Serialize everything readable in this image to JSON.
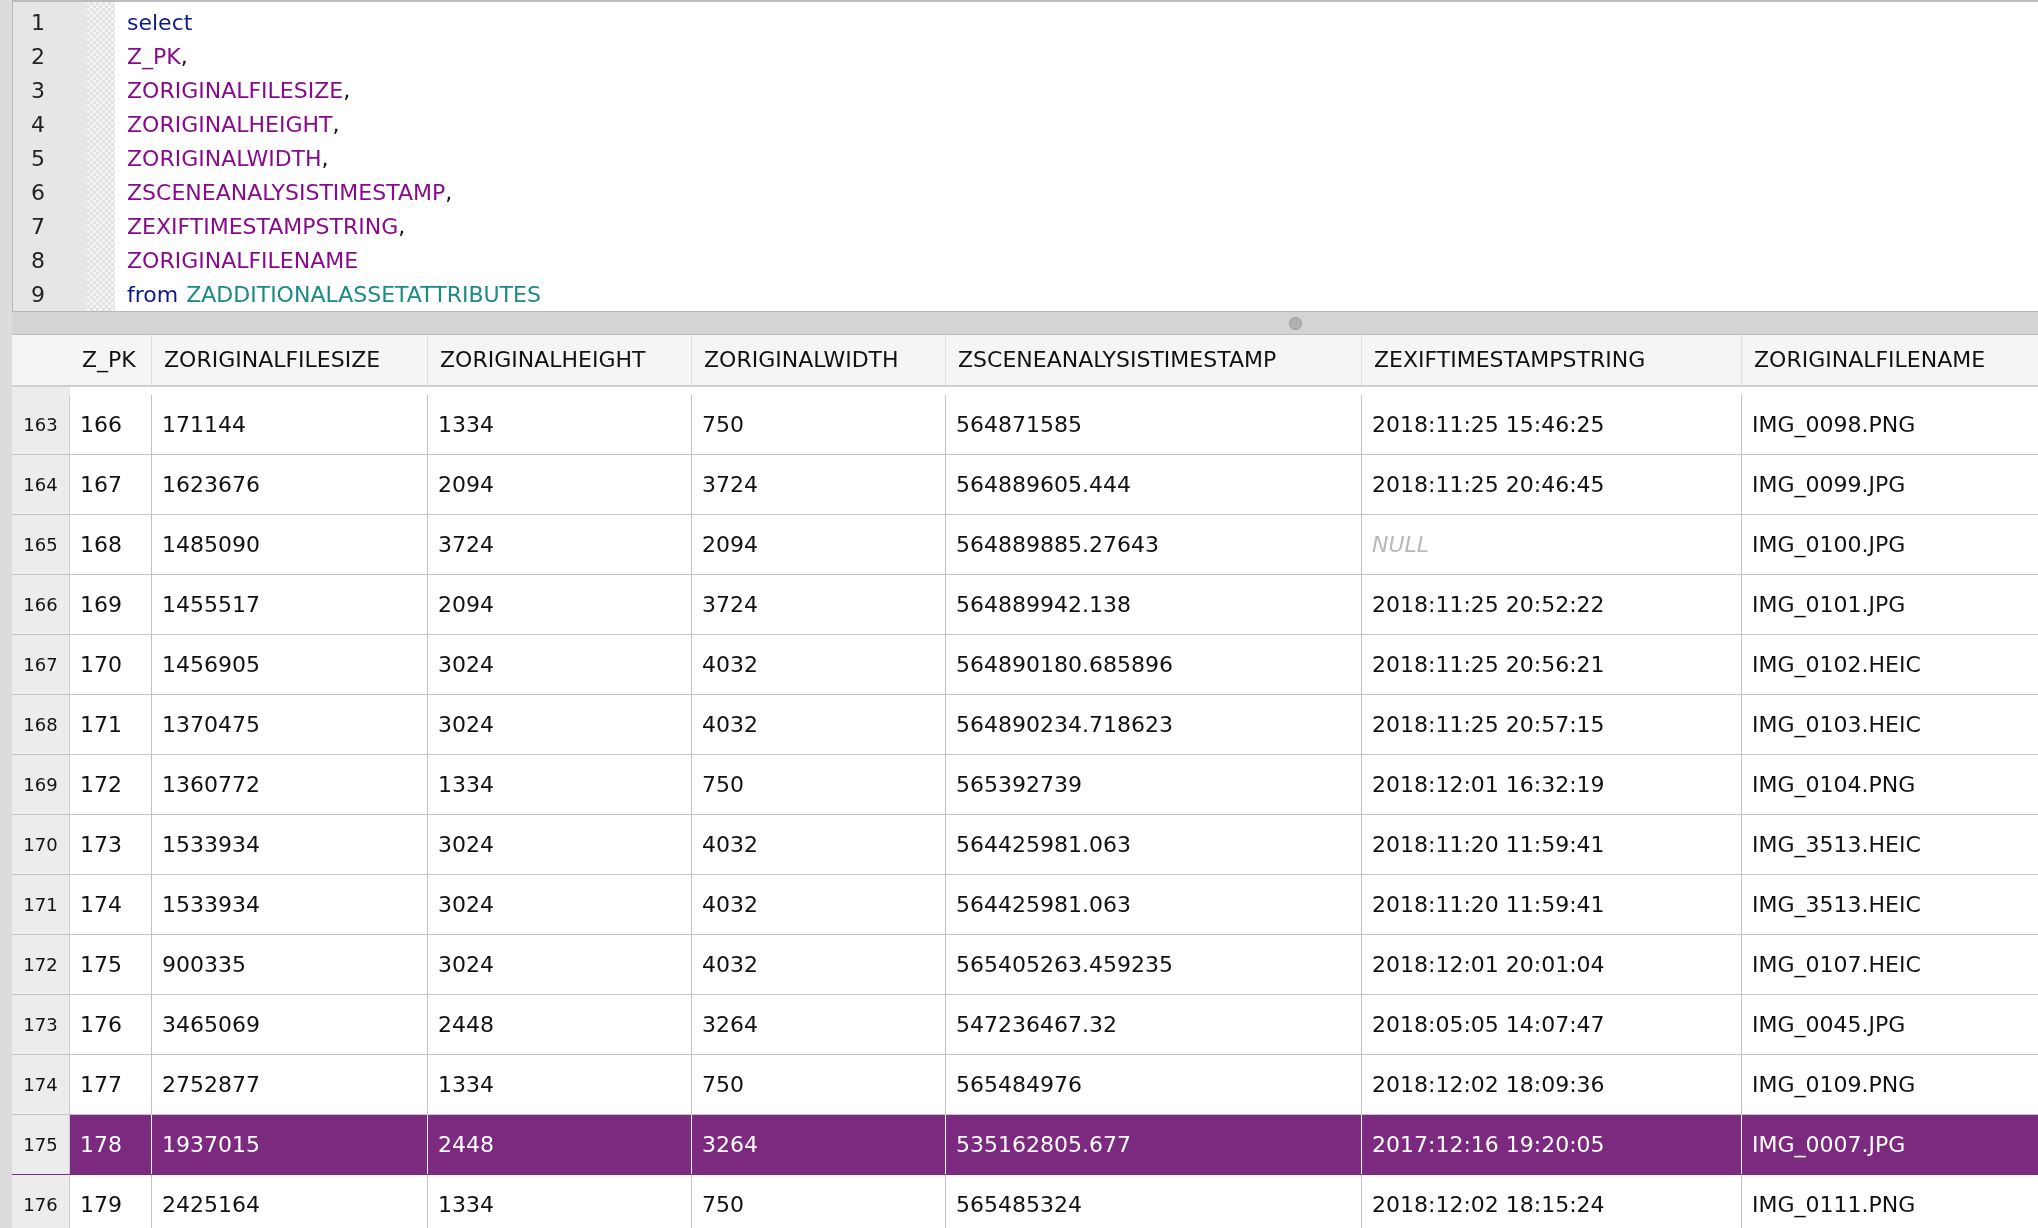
{
  "editor": {
    "lines": [
      {
        "number": "1",
        "tokens": [
          {
            "kind": "keyword",
            "text": "select"
          }
        ]
      },
      {
        "number": "2",
        "tokens": [
          {
            "kind": "column",
            "text": "Z_PK"
          },
          {
            "kind": "punct",
            "text": ","
          }
        ]
      },
      {
        "number": "3",
        "tokens": [
          {
            "kind": "column",
            "text": "ZORIGINALFILESIZE"
          },
          {
            "kind": "punct",
            "text": ","
          }
        ]
      },
      {
        "number": "4",
        "tokens": [
          {
            "kind": "column",
            "text": "ZORIGINALHEIGHT"
          },
          {
            "kind": "punct",
            "text": ","
          }
        ]
      },
      {
        "number": "5",
        "tokens": [
          {
            "kind": "column",
            "text": "ZORIGINALWIDTH"
          },
          {
            "kind": "punct",
            "text": ","
          }
        ]
      },
      {
        "number": "6",
        "tokens": [
          {
            "kind": "column",
            "text": "ZSCENEANALYSISTIMESTAMP"
          },
          {
            "kind": "punct",
            "text": ","
          }
        ]
      },
      {
        "number": "7",
        "tokens": [
          {
            "kind": "column",
            "text": "ZEXIFTIMESTAMPSTRING"
          },
          {
            "kind": "punct",
            "text": ","
          }
        ]
      },
      {
        "number": "8",
        "tokens": [
          {
            "kind": "column",
            "text": "ZORIGINALFILENAME"
          }
        ]
      },
      {
        "number": "9",
        "tokens": [
          {
            "kind": "keyword",
            "text": "from"
          },
          {
            "kind": "table",
            "text": "ZADDITIONALASSETATTRIBUTES"
          }
        ]
      }
    ]
  },
  "results": {
    "columns": [
      "Z_PK",
      "ZORIGINALFILESIZE",
      "ZORIGINALHEIGHT",
      "ZORIGINALWIDTH",
      "ZSCENEANALYSISTIMESTAMP",
      "ZEXIFTIMESTAMPSTRING",
      "ZORIGINALFILENAME"
    ],
    "rows": [
      {
        "number": "163",
        "selected": false,
        "cells": [
          "166",
          "171144",
          "1334",
          "750",
          "564871585",
          "2018:11:25 15:46:25",
          "IMG_0098.PNG"
        ]
      },
      {
        "number": "164",
        "selected": false,
        "cells": [
          "167",
          "1623676",
          "2094",
          "3724",
          "564889605.444",
          "2018:11:25 20:46:45",
          "IMG_0099.JPG"
        ]
      },
      {
        "number": "165",
        "selected": false,
        "cells": [
          "168",
          "1485090",
          "3724",
          "2094",
          "564889885.27643",
          {
            "kind": "null",
            "text": "NULL"
          },
          "IMG_0100.JPG"
        ]
      },
      {
        "number": "166",
        "selected": false,
        "cells": [
          "169",
          "1455517",
          "2094",
          "3724",
          "564889942.138",
          "2018:11:25 20:52:22",
          "IMG_0101.JPG"
        ]
      },
      {
        "number": "167",
        "selected": false,
        "cells": [
          "170",
          "1456905",
          "3024",
          "4032",
          "564890180.685896",
          "2018:11:25 20:56:21",
          "IMG_0102.HEIC"
        ]
      },
      {
        "number": "168",
        "selected": false,
        "cells": [
          "171",
          "1370475",
          "3024",
          "4032",
          "564890234.718623",
          "2018:11:25 20:57:15",
          "IMG_0103.HEIC"
        ]
      },
      {
        "number": "169",
        "selected": false,
        "cells": [
          "172",
          "1360772",
          "1334",
          "750",
          "565392739",
          "2018:12:01 16:32:19",
          "IMG_0104.PNG"
        ]
      },
      {
        "number": "170",
        "selected": false,
        "cells": [
          "173",
          "1533934",
          "3024",
          "4032",
          "564425981.063",
          "2018:11:20 11:59:41",
          "IMG_3513.HEIC"
        ]
      },
      {
        "number": "171",
        "selected": false,
        "cells": [
          "174",
          "1533934",
          "3024",
          "4032",
          "564425981.063",
          "2018:11:20 11:59:41",
          "IMG_3513.HEIC"
        ]
      },
      {
        "number": "172",
        "selected": false,
        "cells": [
          "175",
          "900335",
          "3024",
          "4032",
          "565405263.459235",
          "2018:12:01 20:01:04",
          "IMG_0107.HEIC"
        ]
      },
      {
        "number": "173",
        "selected": false,
        "cells": [
          "176",
          "3465069",
          "2448",
          "3264",
          "547236467.32",
          "2018:05:05 14:07:47",
          "IMG_0045.JPG"
        ]
      },
      {
        "number": "174",
        "selected": false,
        "cells": [
          "177",
          "2752877",
          "1334",
          "750",
          "565484976",
          "2018:12:02 18:09:36",
          "IMG_0109.PNG"
        ]
      },
      {
        "number": "175",
        "selected": true,
        "cells": [
          "178",
          "1937015",
          "2448",
          "3264",
          "535162805.677",
          "2017:12:16 19:20:05",
          "IMG_0007.JPG"
        ]
      },
      {
        "number": "176",
        "selected": false,
        "cells": [
          "179",
          "2425164",
          "1334",
          "750",
          "565485324",
          "2018:12:02 18:15:24",
          "IMG_0111.PNG"
        ]
      }
    ]
  }
}
